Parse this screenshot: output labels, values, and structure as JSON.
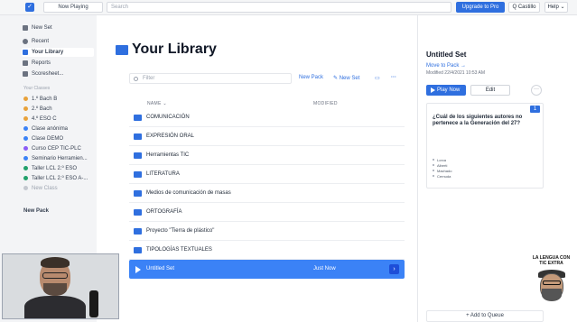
{
  "topbar": {
    "now_playing_label": "Now Playing",
    "search_placeholder": "Search",
    "upgrade_label": "Upgrade to Pro",
    "user_label": "Q Castillo",
    "help_label": "Help ⌄"
  },
  "sidebar": {
    "new_set": "New Set",
    "recent": "Recent",
    "your_library": "Your Library",
    "reports": "Reports",
    "scoresheet": "Scoresheet...",
    "classes_heading": "Your Classes",
    "classes": [
      {
        "label": "1.º Bach B",
        "color": "#e8a23b"
      },
      {
        "label": "2.º Bach",
        "color": "#e8a23b"
      },
      {
        "label": "4.º ESO C",
        "color": "#e8a23b"
      },
      {
        "label": "Clase anónima",
        "color": "#3b82f6"
      },
      {
        "label": "Clase DEMO",
        "color": "#3b82f6"
      },
      {
        "label": "Curso CEP TIC-PLC",
        "color": "#8b5cf6"
      },
      {
        "label": "Seminario Herramien...",
        "color": "#3b82f6"
      },
      {
        "label": "Taller LCL 2.º ESO",
        "color": "#22a06b"
      },
      {
        "label": "Taller LCL 2.º ESO A-...",
        "color": "#22a06b"
      },
      {
        "label": "New Class",
        "color": "#c4c8cf"
      }
    ],
    "new_pack": "New Pack"
  },
  "main": {
    "title": "Your Library",
    "filter_placeholder": "Filter",
    "new_pack": "New Pack",
    "new_set": "New Set",
    "col_name": "NAME ⌄",
    "col_modified": "MODIFIED",
    "folders": [
      "COMUNICACIÓN",
      "EXPRESIÓN ORAL",
      "Herramientas TIC",
      "LITERATURA",
      "Medios de comunicación de masas",
      "ORTOGRAFÍA",
      "Proyecto \"Tierra de plástico\"",
      "TIPOLOGÍAS TEXTUALES"
    ],
    "selected_set": {
      "name": "Untitled Set",
      "modified": "Just Now"
    }
  },
  "panel": {
    "title": "Untitled Set",
    "move_to_pack": "Move to Pack →",
    "modified": "Modified 22/4/2021 10:53 AM",
    "play_now": "Play Now",
    "edit": "Edit",
    "question_number": "1",
    "question_text": "¿Cuál de los siguientes autores no pertenece a la Generación del 27?",
    "options": [
      "Lorca",
      "Alberti",
      "Machado",
      "Cernuda"
    ],
    "add_to_queue": "+ Add to Queue"
  },
  "logo": {
    "text": "LA LENGUA CON TIC EXTRA"
  }
}
